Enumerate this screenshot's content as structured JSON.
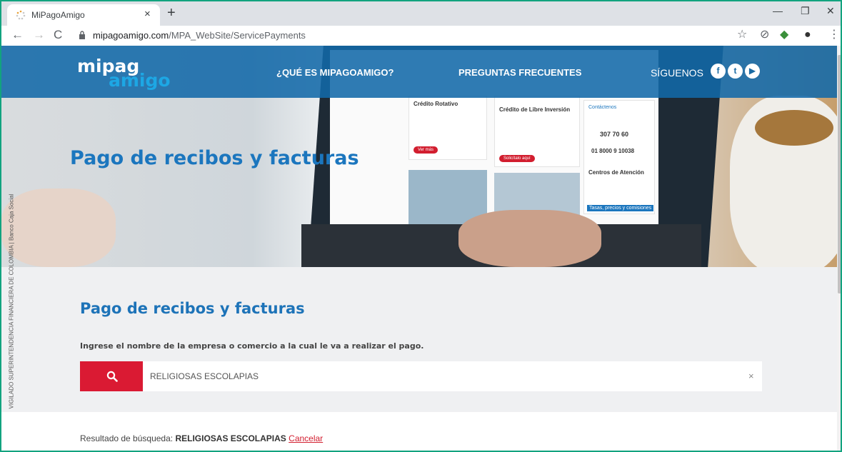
{
  "browser": {
    "tab_title": "MiPagoAmigo",
    "url_host": "mipagoamigo.com",
    "url_path": "/MPA_WebSite/ServicePayments"
  },
  "header": {
    "logo_top": "mipag",
    "logo_bottom": "amigo",
    "nav": [
      {
        "label": "¿QUÉ ES MIPAGOAMIGO?"
      },
      {
        "label": "PREGUNTAS FRECUENTES"
      }
    ],
    "social_label": "SÍGUENOS",
    "colors": {
      "bar": "#1269a8",
      "accent": "#1da7e4"
    }
  },
  "hero": {
    "title": "Pago de recibos y facturas",
    "screen": {
      "card1_title": "Crédito Rotativo",
      "card1_button": "Ver más",
      "card2_title": "Crédito de Libre Inversión",
      "card2_button": "Solicítalo aquí",
      "contact_title": "Contáctenos",
      "phone_1": "307 70 60",
      "phone_2": "01 8000 9 10038",
      "centers": "Centros de Atención",
      "rates": "Tasas, precios y comisiones"
    }
  },
  "vigilado": {
    "text": "VIGILADO SUPERINTENDENCIA FINANCIERA DE COLOMBIA | Banco Caja Social"
  },
  "main": {
    "title": "Pago de recibos y facturas",
    "instruction": "Ingrese el nombre de la empresa o comercio a la cual le va a realizar el pago.",
    "search_value": "RELIGIOSAS ESCOLAPIAS",
    "results_label": "Resultado de búsqueda:",
    "results_term": "RELIGIOSAS ESCOLAPIAS",
    "cancel_label": "Cancelar",
    "colors": {
      "search_button": "#da1a33",
      "title": "#1d73b8"
    }
  }
}
